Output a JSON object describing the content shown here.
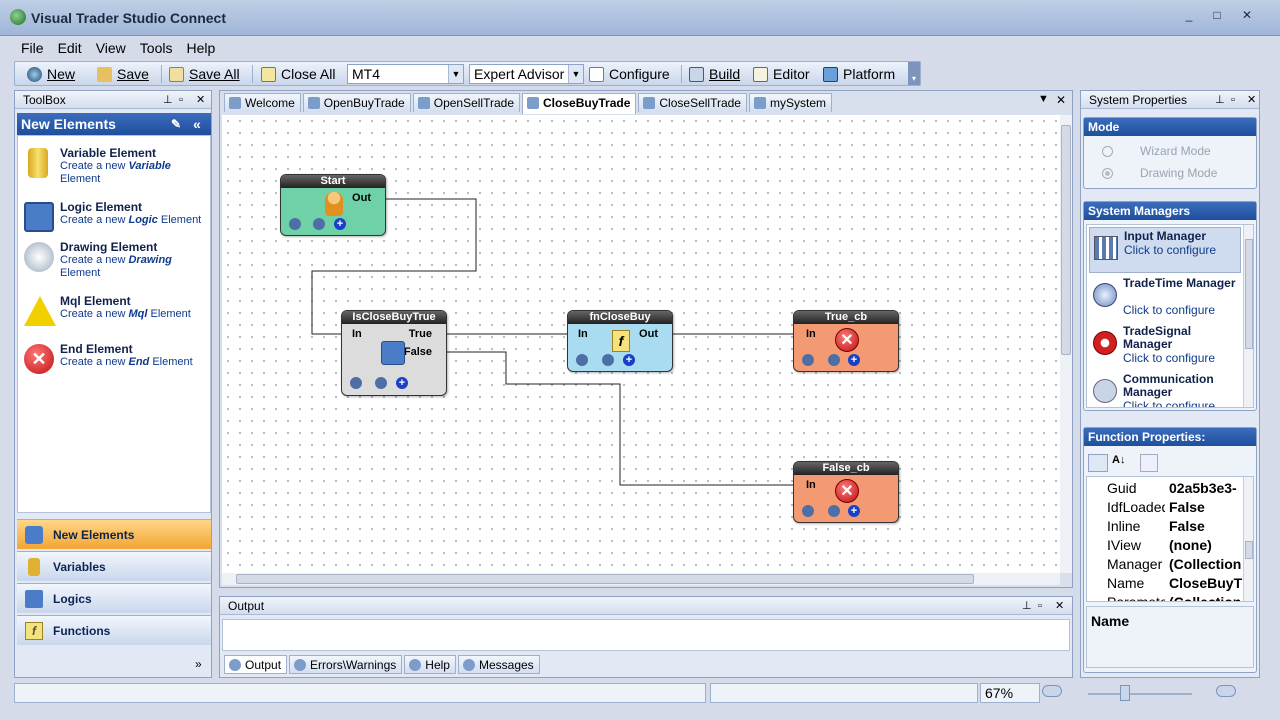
{
  "window": {
    "title": "Visual Trader Studio Connect",
    "controls": [
      "_",
      "□",
      "✕"
    ]
  },
  "menu": [
    "File",
    "Edit",
    "View",
    "Tools",
    "Help"
  ],
  "toolbar": {
    "new": "New",
    "save": "Save",
    "save_all": "Save All",
    "close_all": "Close All",
    "platform_combo": "MT4",
    "type_combo": "Expert Advisor",
    "configure": "Configure",
    "build": "Build",
    "editor": "Editor",
    "platform": "Platform"
  },
  "toolbox": {
    "title": "ToolBox",
    "section": "New Elements",
    "elements": [
      {
        "name": "Variable Element",
        "pre": "Create a new ",
        "em": "Variable",
        "post": " Element"
      },
      {
        "name": "Logic Element",
        "pre": "Create a new ",
        "em": "Logic",
        "post": " Element"
      },
      {
        "name": "Drawing Element",
        "pre": "Create a new ",
        "em": "Drawing",
        "post": " Element"
      },
      {
        "name": "Mql Element",
        "pre": "Create a new ",
        "em": "Mql",
        "post": " Element"
      },
      {
        "name": "End Element",
        "pre": "Create a new ",
        "em": "End",
        "post": " Element"
      }
    ],
    "categories": [
      "New Elements",
      "Variables",
      "Logics",
      "Functions"
    ]
  },
  "tabs": [
    "Welcome",
    "OpenBuyTrade",
    "OpenSellTrade",
    "CloseBuyTrade",
    "CloseSellTrade",
    "mySystem"
  ],
  "active_tab": "CloseBuyTrade",
  "nodes": {
    "start": {
      "title": "Start",
      "out": "Out"
    },
    "is_close": {
      "title": "IsCloseBuyTrue",
      "in": "In",
      "true": "True",
      "false": "False"
    },
    "fn_close": {
      "title": "fnCloseBuy",
      "in": "In",
      "out": "Out",
      "glyph": "f"
    },
    "true_cb": {
      "title": "True_cb",
      "in": "In"
    },
    "false_cb": {
      "title": "False_cb",
      "in": "In"
    }
  },
  "output": {
    "title": "Output",
    "tabs": [
      "Output",
      "Errors\\Warnings",
      "Help",
      "Messages"
    ]
  },
  "system_properties": {
    "title": "System Properties",
    "mode": {
      "title": "Mode",
      "options": [
        "Wizard Mode",
        "Drawing Mode"
      ]
    },
    "managers_title": "System Managers",
    "managers": [
      {
        "name": "Input Manager",
        "action": "Click to configure"
      },
      {
        "name": "TradeTime Manager",
        "action": "Click to configure"
      },
      {
        "name": "TradeSignal Manager",
        "action": "Click to configure"
      },
      {
        "name": "Communication Manager",
        "action": "Click to configure"
      }
    ],
    "function_props_title": "Function Properties:",
    "props": [
      {
        "k": "Guid",
        "v": "02a5b3e3-"
      },
      {
        "k": "IdfLoaded",
        "v": "False"
      },
      {
        "k": "Inline",
        "v": "False"
      },
      {
        "k": "IView",
        "v": "(none)"
      },
      {
        "k": "Manager",
        "v": "(Collection"
      },
      {
        "k": "Name",
        "v": "CloseBuyT"
      },
      {
        "k": "Parameters",
        "v": "(Collection"
      }
    ],
    "selected_prop": "Name"
  },
  "status": {
    "zoom": "67%"
  }
}
